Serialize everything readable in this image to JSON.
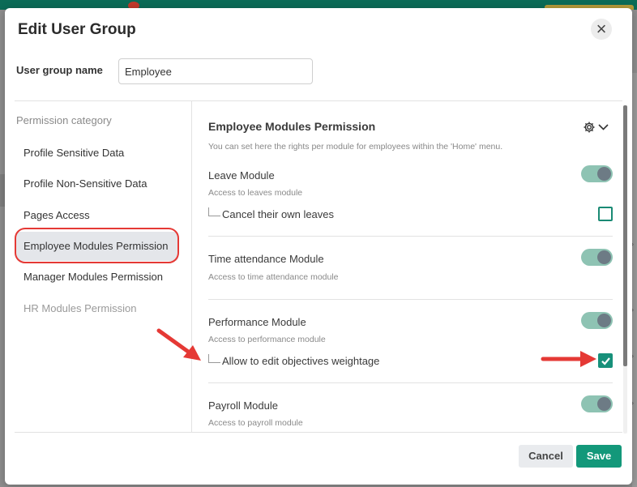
{
  "dialog": {
    "title": "Edit User Group",
    "close_icon": "close-icon"
  },
  "group_name": {
    "label": "User group name",
    "value": "Employee"
  },
  "categories": {
    "title": "Permission category",
    "items": [
      {
        "label": "Profile Sensitive Data"
      },
      {
        "label": "Profile Non-Sensitive Data"
      },
      {
        "label": "Pages Access"
      },
      {
        "label": "Employee Modules Permission",
        "selected": true
      },
      {
        "label": "Manager Modules Permission"
      },
      {
        "label": "HR Modules Permission",
        "disabled": true
      }
    ]
  },
  "panel": {
    "title": "Employee Modules Permission",
    "description": "You can set here the rights per module for employees within the 'Home' menu.",
    "settings_icon": "gear-icon",
    "modules": [
      {
        "name": "Leave Module",
        "description": "Access to leaves module",
        "enabled": true,
        "sub": {
          "label": "Cancel their own leaves",
          "checked": false
        }
      },
      {
        "name": "Time attendance Module",
        "description": "Access to time attendance module",
        "enabled": true
      },
      {
        "name": "Performance Module",
        "description": "Access to performance module",
        "enabled": true,
        "sub": {
          "label": "Allow to edit objectives weightage",
          "checked": true
        }
      },
      {
        "name": "Payroll Module",
        "description": "Access to payroll module",
        "enabled": true
      }
    ]
  },
  "footer": {
    "cancel_label": "Cancel",
    "save_label": "Save"
  },
  "colors": {
    "accent": "#13987a",
    "toggle_track": "#8ec3b3",
    "annotation_red": "#e53935"
  }
}
